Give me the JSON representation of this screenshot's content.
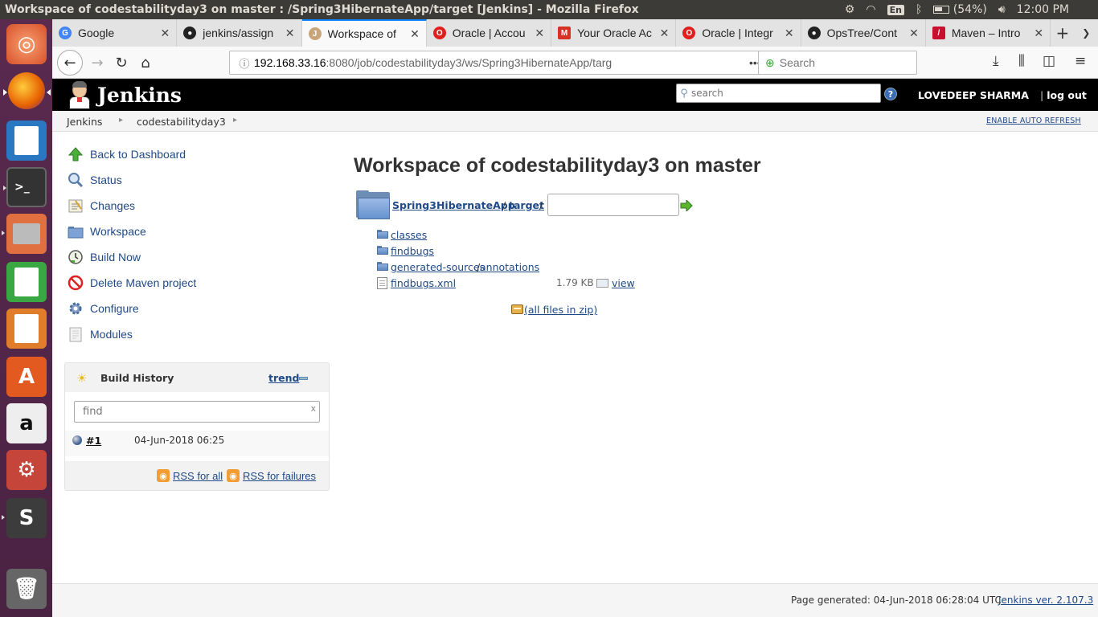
{
  "os": {
    "window_title": "Workspace of codestabilityday3 on master : /Spring3HibernateApp/target [Jenkins] - Mozilla Firefox",
    "keyboard": "En",
    "battery": "(54%)",
    "clock": "12:00 PM"
  },
  "browser": {
    "tabs": [
      {
        "label": "Google",
        "icon_color": "#4285f4",
        "icon": "G"
      },
      {
        "label": "jenkins/assign",
        "icon_color": "#222222",
        "icon": "github"
      },
      {
        "label": "Workspace of",
        "icon_color": "#c9a57a",
        "icon": "jenkins"
      },
      {
        "label": "Oracle | Accou",
        "icon_color": "#e0201c",
        "icon": "oracle"
      },
      {
        "label": "Your Oracle Ac",
        "icon_color": "#d93025",
        "icon": "gmail"
      },
      {
        "label": "Oracle | Integr",
        "icon_color": "#e0201c",
        "icon": "oracle"
      },
      {
        "label": "OpsTree/Cont",
        "icon_color": "#222222",
        "icon": "github"
      },
      {
        "label": "Maven – Intro",
        "icon_color": "#c8102e",
        "icon": "maven"
      }
    ],
    "url_host": "192.168.33.16",
    "url_rest": ":8080/job/codestabilityday3/ws/Spring3HibernateApp/targ",
    "search_placeholder": "Search"
  },
  "jenkins": {
    "brand": "Jenkins",
    "search_placeholder": "search",
    "user": "LOVEDEEP SHARMA",
    "logout": "log out",
    "breadcrumbs": [
      "Jenkins",
      "codestabilityday3"
    ],
    "auto_refresh": "ENABLE AUTO REFRESH",
    "tasks": [
      "Back to Dashboard",
      "Status",
      "Changes",
      "Workspace",
      "Build Now",
      "Delete Maven project",
      "Configure",
      "Modules"
    ],
    "build_history": {
      "title": "Build History",
      "trend": "trend",
      "find_placeholder": "find",
      "find_clear": "x",
      "builds": [
        {
          "number": "#1",
          "date": "04-Jun-2018 06:25"
        }
      ],
      "rss_all": "RSS for all",
      "rss_failures": "RSS for failures"
    },
    "main": {
      "title": "Workspace of codestabilityday3 on master",
      "path": [
        "Spring3HibernateApp",
        "target"
      ],
      "path_sep": "/",
      "files": {
        "classes": "classes",
        "findbugs": "findbugs",
        "generated_sources": "generated-sources",
        "annotations": "annotations",
        "findbugs_xml": "findbugs.xml",
        "findbugs_xml_size": "1.79 KB",
        "view": "view"
      },
      "zip": "(all files in zip)"
    },
    "footer": {
      "generated": "Page generated: 04-Jun-2018 06:28:04 UTC",
      "version": "Jenkins ver. 2.107.3"
    }
  }
}
